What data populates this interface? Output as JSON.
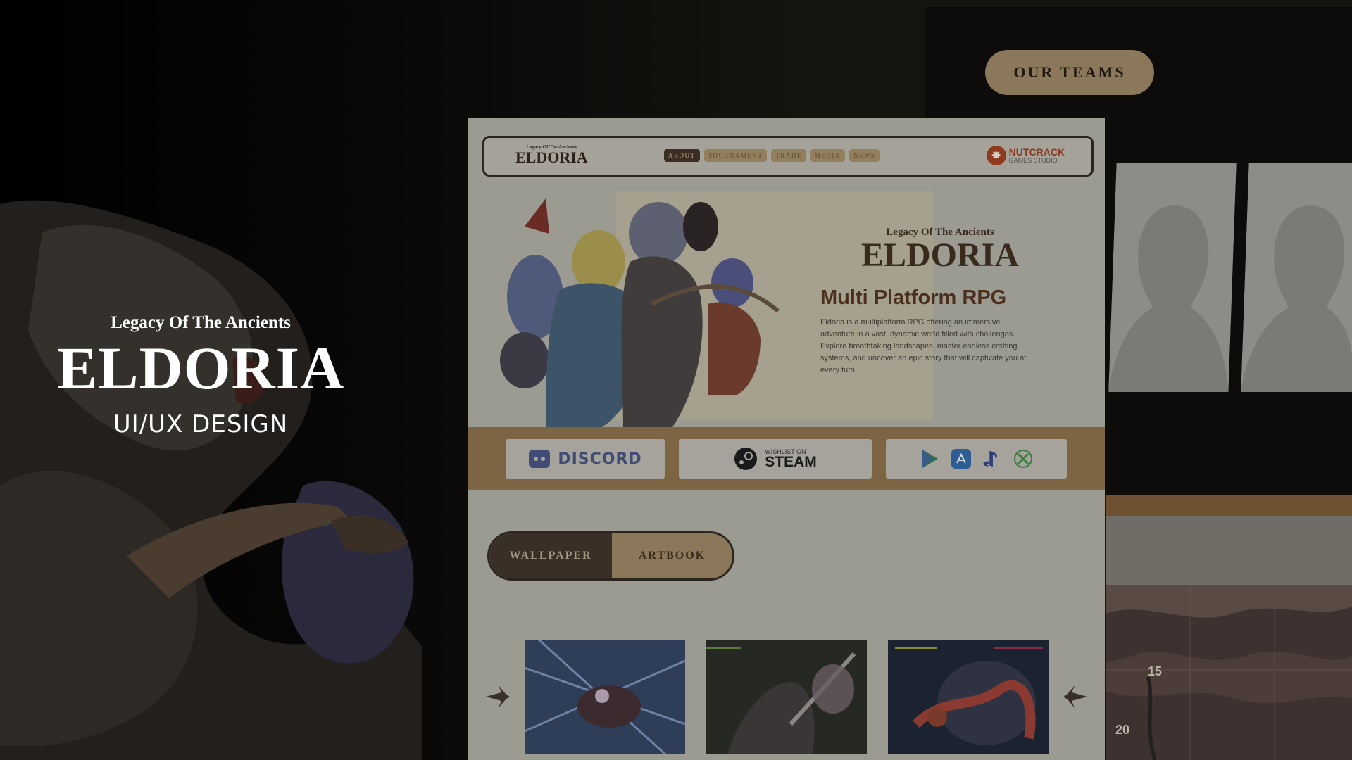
{
  "left_panel": {
    "subtitle": "Legacy Of The Ancients",
    "logo": "ELDORIA",
    "tagline": "UI/UX DESIGN"
  },
  "teams": {
    "button_label": "OUR TEAMS"
  },
  "map": {
    "labels": [
      "15",
      "20"
    ]
  },
  "site": {
    "nav": {
      "logo_sub": "Legacy Of The Ancients",
      "logo": "ELDORIA",
      "items": [
        "ABOUT",
        "TOURNAMENT",
        "TRADE",
        "MEDIA",
        "NEWS"
      ],
      "active_index": 0,
      "brand_top": "NUTCRACK",
      "brand_bottom": "GAMES STUDIO"
    },
    "hero": {
      "subtitle": "Legacy Of The Ancients",
      "logo": "ELDORIA",
      "heading": "Multi Platform RPG",
      "description": "Eldoria is a multiplatform RPG offering an immersive adventure in a vast, dynamic world filled with challenges. Explore breathtaking landscapes, master endless crafting systems, and uncover an epic story that will captivate you at every turn."
    },
    "platforms": {
      "discord": "DISCORD",
      "steam_wish": "WISHLIST ON",
      "steam": "STEAM",
      "stores": [
        "google-play-icon",
        "app-store-icon",
        "playstation-icon",
        "xbox-icon"
      ]
    },
    "tabs": [
      "WALLPAPER",
      "ARTBOOK"
    ],
    "active_tab": "WALLPAPER"
  },
  "colors": {
    "accent": "#8b7759",
    "dark": "#3a2f26",
    "brand": "#8d3a1f"
  }
}
